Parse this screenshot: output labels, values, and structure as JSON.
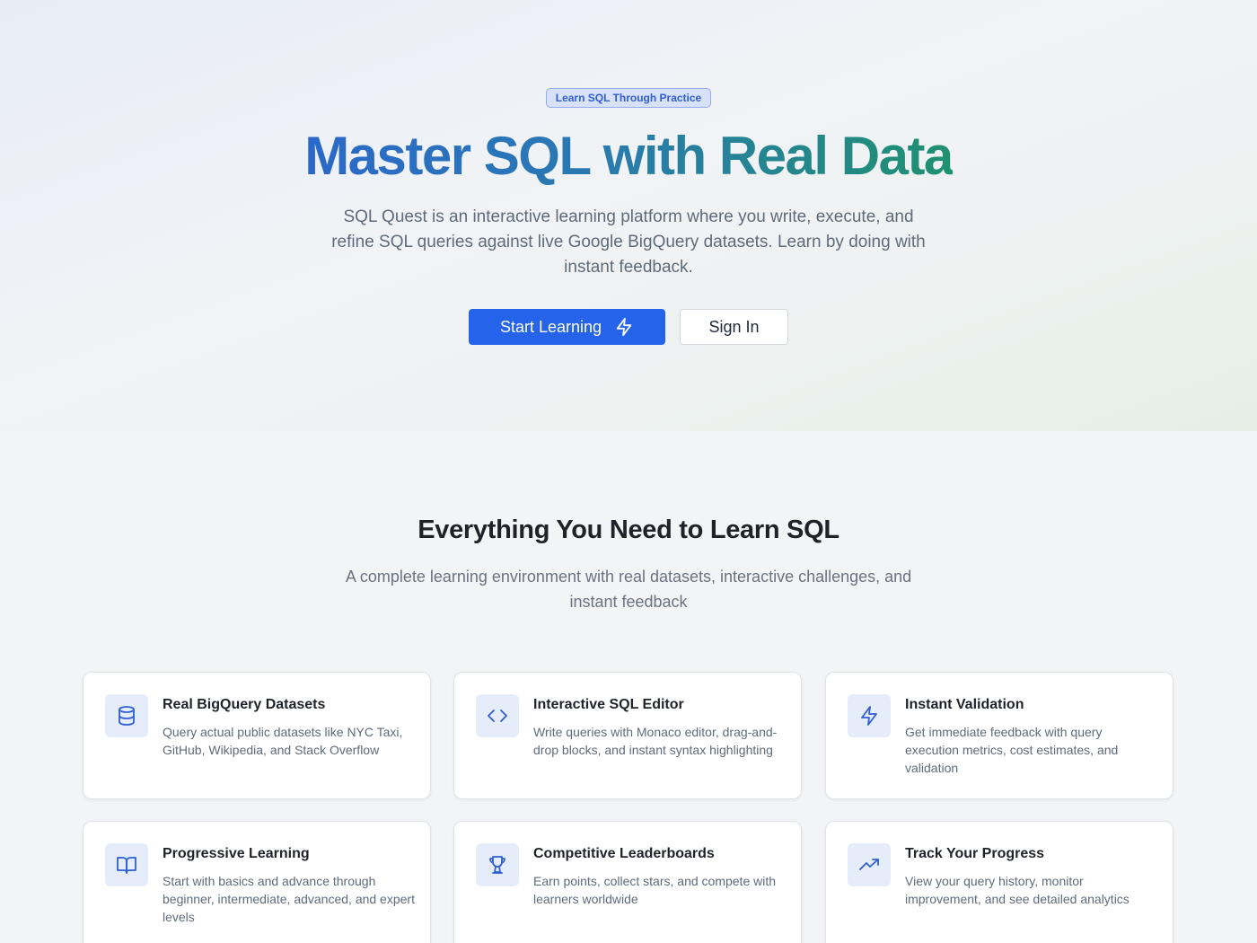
{
  "hero": {
    "badge": "Learn SQL Through Practice",
    "title": "Master SQL with Real Data",
    "subtitle": "SQL Quest is an interactive learning platform where you write, execute, and refine SQL queries against live Google BigQuery datasets. Learn by doing with instant feedback.",
    "primary_button": "Start Learning",
    "primary_button_icon": "lightning-icon",
    "secondary_button": "Sign In"
  },
  "features": {
    "title": "Everything You Need to Learn SQL",
    "subtitle": "A complete learning environment with real datasets, interactive challenges, and instant feedback",
    "cards": [
      {
        "icon": "database-icon",
        "title": "Real BigQuery Datasets",
        "description": "Query actual public datasets like NYC Taxi, GitHub, Wikipedia, and Stack Overflow"
      },
      {
        "icon": "code-icon",
        "title": "Interactive SQL Editor",
        "description": "Write queries with Monaco editor, drag-and-drop blocks, and instant syntax highlighting"
      },
      {
        "icon": "lightning-icon",
        "title": "Instant Validation",
        "description": "Get immediate feedback with query execution metrics, cost estimates, and validation"
      },
      {
        "icon": "book-open-icon",
        "title": "Progressive Learning",
        "description": "Start with basics and advance through beginner, intermediate, advanced, and expert levels"
      },
      {
        "icon": "trophy-icon",
        "title": "Competitive Leaderboards",
        "description": "Earn points, collect stars, and compete with learners worldwide"
      },
      {
        "icon": "trending-up-icon",
        "title": "Track Your Progress",
        "description": "View your query history, monitor improvement, and see detailed analytics"
      }
    ]
  },
  "colors": {
    "accent": "#2563eb",
    "icon_stroke": "#2f5fd3",
    "icon_bg": "#e6edfa",
    "title_gradient_start": "#2b68c9",
    "title_gradient_end": "#1f9170"
  }
}
